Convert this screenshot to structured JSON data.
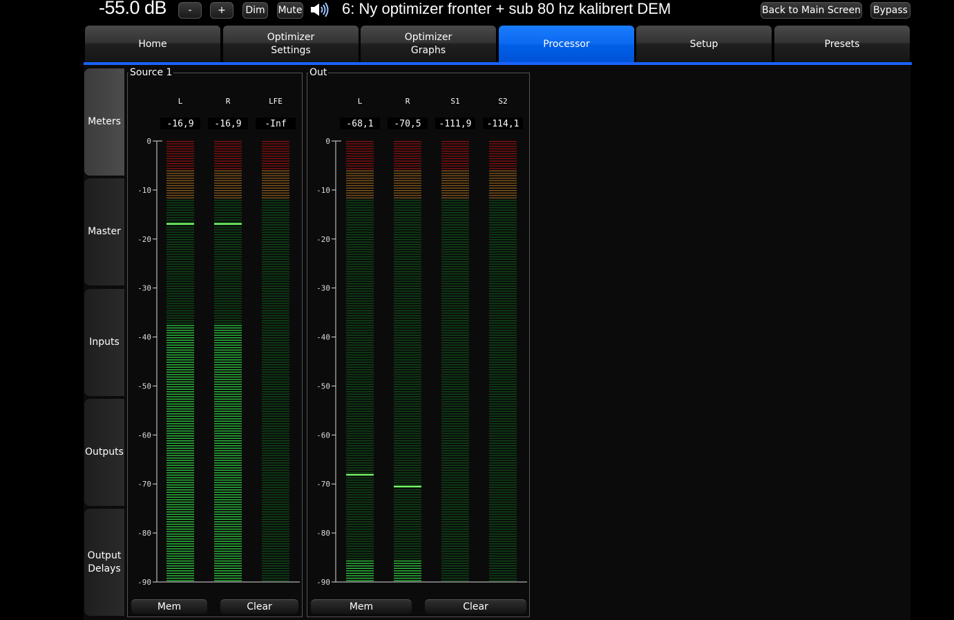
{
  "header": {
    "volume": "-55.0 dB",
    "vol_down_label": "-",
    "vol_up_label": "+",
    "dim_label": "Dim",
    "mute_label": "Mute",
    "preset_title": "6: Ny optimizer fronter + sub 80 hz kalibrert DEM",
    "back_label": "Back to Main Screen",
    "bypass_label": "Bypass"
  },
  "tabs": [
    {
      "label": "Home"
    },
    {
      "label": "Optimizer\nSettings"
    },
    {
      "label": "Optimizer\nGraphs"
    },
    {
      "label": "Processor"
    },
    {
      "label": "Setup"
    },
    {
      "label": "Presets"
    }
  ],
  "active_tab": "Processor",
  "sidebar": [
    {
      "label": "Meters"
    },
    {
      "label": "Master"
    },
    {
      "label": "Inputs"
    },
    {
      "label": "Outputs"
    },
    {
      "label": "Output\nDelays"
    }
  ],
  "scale_labels": [
    "0",
    "-10",
    "-20",
    "-30",
    "-40",
    "-50",
    "-60",
    "-70",
    "-80",
    "-90"
  ],
  "meters": {
    "source": {
      "title": "Source 1",
      "channels": [
        {
          "name": "L",
          "readout": "-16,9",
          "peak_db": -16.9,
          "level_db": -37.5
        },
        {
          "name": "R",
          "readout": "-16,9",
          "peak_db": -16.9,
          "level_db": -37.5
        },
        {
          "name": "LFE",
          "readout": "-Inf",
          "peak_db": null,
          "level_db": null
        }
      ],
      "mem_label": "Mem",
      "clear_label": "Clear"
    },
    "out": {
      "title": "Out",
      "channels": [
        {
          "name": "L",
          "readout": "-68,1",
          "peak_db": -68.1,
          "level_db": -85.5
        },
        {
          "name": "R",
          "readout": "-70,5",
          "peak_db": -70.5,
          "level_db": -85.5
        },
        {
          "name": "S1",
          "readout": "-111,9",
          "peak_db": null,
          "level_db": null
        },
        {
          "name": "S2",
          "readout": "-114,1",
          "peak_db": null,
          "level_db": null
        }
      ],
      "mem_label": "Mem",
      "clear_label": "Clear"
    }
  },
  "colors": {
    "accent": "#1a63ff",
    "active_tab": "#0b6af0",
    "meter_red": "#8a1010",
    "meter_amber": "#8a5a1c",
    "meter_green_dim": "#0e4d18",
    "meter_green_lit": "#2ecc40",
    "meter_peak": "#7dff6a"
  }
}
